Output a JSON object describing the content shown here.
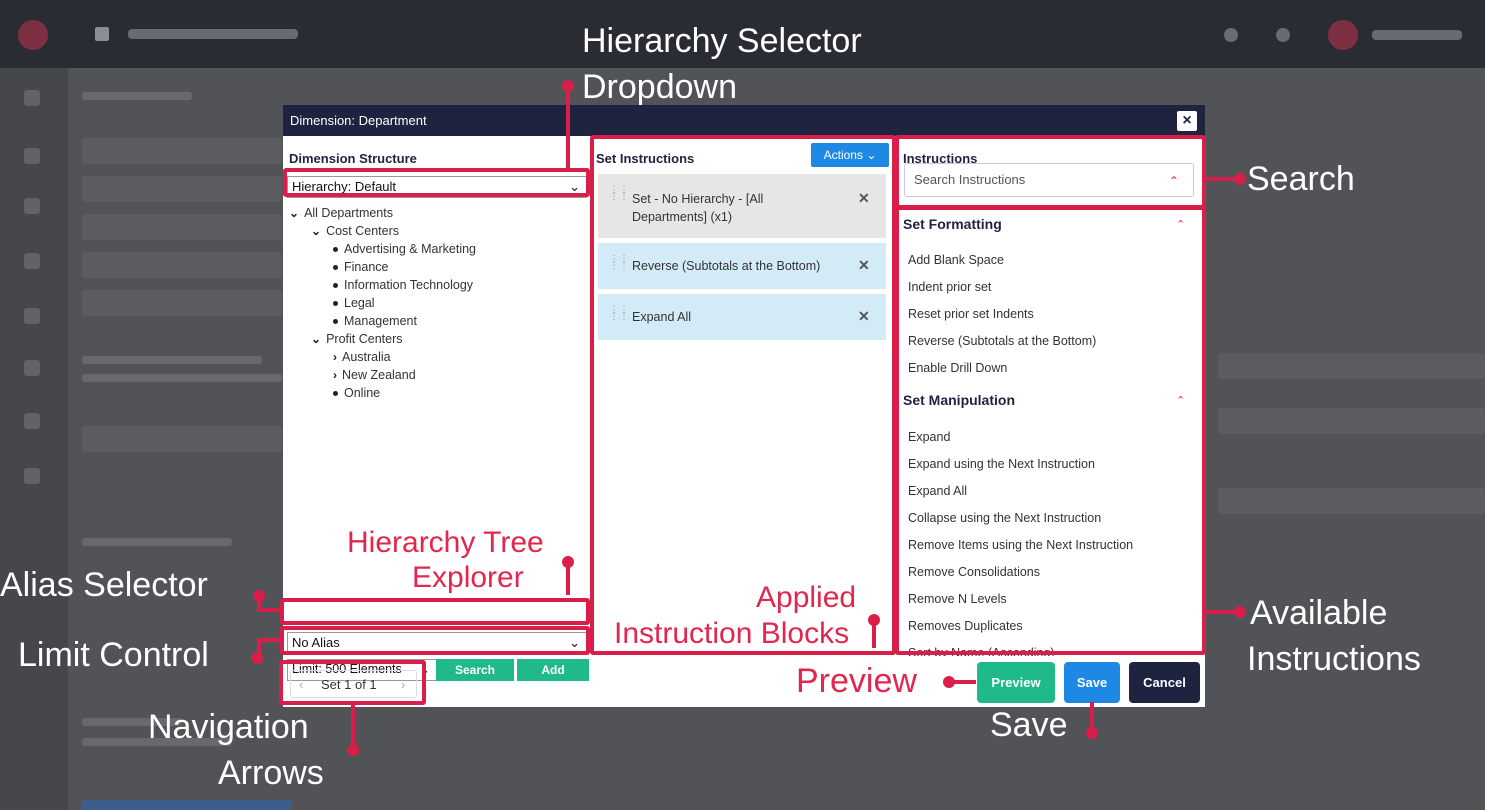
{
  "modal": {
    "title": "Dimension: Department",
    "close_icon": "close-icon",
    "structure": {
      "heading": "Dimension Structure",
      "hierarchy_value": "Hierarchy: Default",
      "tree": {
        "root": "All Departments",
        "cost_centers": "Cost Centers",
        "cc_children": [
          "Advertising & Marketing",
          "Finance",
          "Information Technology",
          "Legal",
          "Management"
        ],
        "profit_centers": "Profit Centers",
        "pc_children": [
          "Australia",
          "New Zealand",
          "Online"
        ]
      },
      "alias_value": "No Alias",
      "limit_value": "Limit: 500 Elements",
      "search_label": "Search",
      "add_label": "Add"
    },
    "set_instructions": {
      "heading": "Set Instructions",
      "actions_label": "Actions",
      "blocks": [
        {
          "text": "Set - No Hierarchy - [All Departments] (x1)",
          "selected": false
        },
        {
          "text": "Reverse (Subtotals at the Bottom)",
          "selected": true
        },
        {
          "text": "Expand All",
          "selected": true
        }
      ]
    },
    "instructions": {
      "heading": "Instructions",
      "search_placeholder": "Search Instructions",
      "sections": [
        {
          "title": "Set Formatting",
          "items": [
            "Add Blank Space",
            "Indent prior set",
            "Reset prior set Indents",
            "Reverse (Subtotals at the Bottom)",
            "Enable Drill Down"
          ]
        },
        {
          "title": "Set Manipulation",
          "items": [
            "Expand",
            "Expand using the Next Instruction",
            "Expand All",
            "Collapse using the Next Instruction",
            "Remove Items using the Next Instruction",
            "Remove Consolidations",
            "Remove N Levels",
            "Removes Duplicates",
            "Sort by Name (Ascending)"
          ]
        }
      ]
    },
    "footer": {
      "pager": "Set 1 of 1",
      "preview_label": "Preview",
      "save_label": "Save",
      "cancel_label": "Cancel"
    }
  },
  "annotations": {
    "hierarchy_dropdown": [
      "Hierarchy Selector",
      "Dropdown"
    ],
    "search": "Search",
    "available": [
      "Available",
      "Instructions"
    ],
    "alias": "Alias Selector",
    "limit": "Limit Control",
    "navigation": [
      "Navigation",
      "Arrows"
    ],
    "tree": [
      "Hierarchy Tree",
      "Explorer"
    ],
    "applied": [
      "Applied",
      "Instruction Blocks"
    ],
    "preview": "Preview",
    "save": "Save"
  },
  "colors": {
    "accent": "#d91e4a",
    "header": "#1e2340",
    "primary": "#1e88e5",
    "success": "#20b98a",
    "selected_block": "#d3ebf7"
  }
}
